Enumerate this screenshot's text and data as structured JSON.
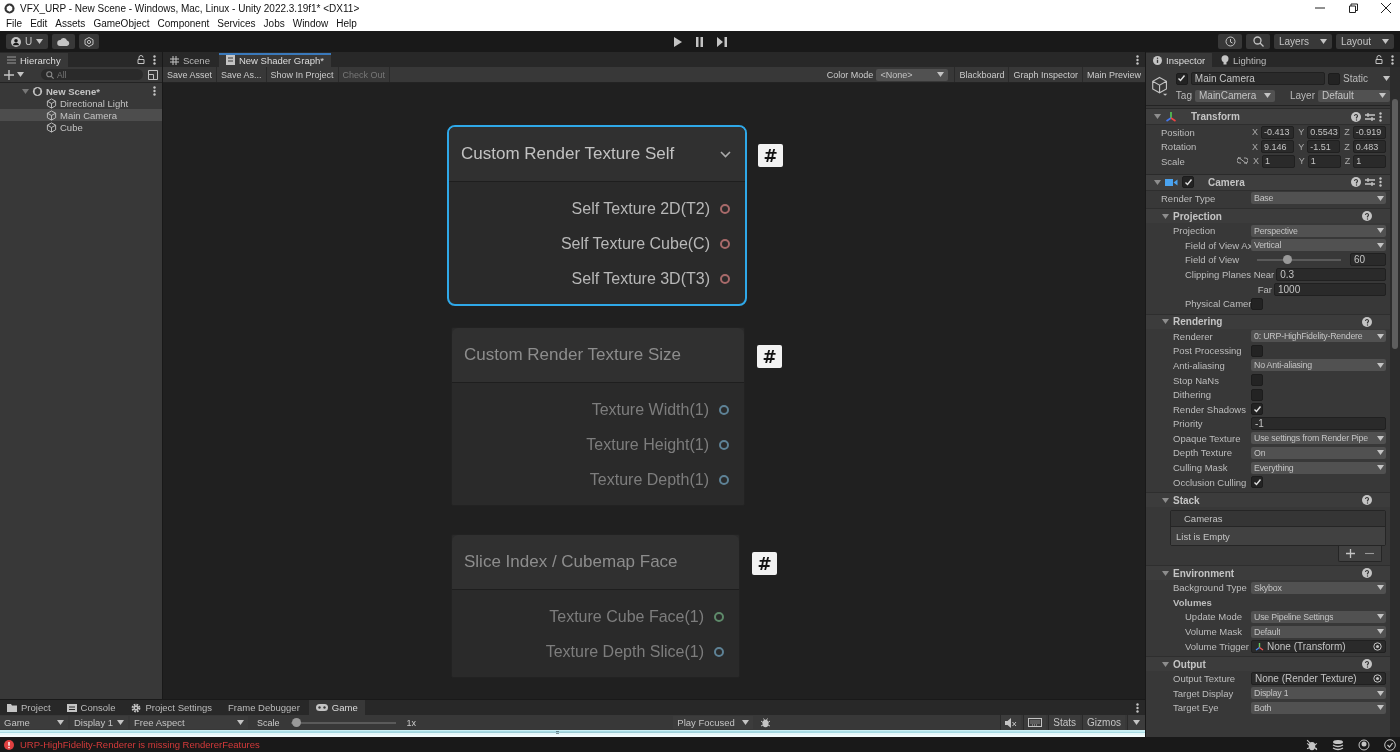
{
  "window": {
    "title": "VFX_URP - New Scene - Windows, Mac, Linux - Unity 2022.3.19f1* <DX11>"
  },
  "menu": [
    "File",
    "Edit",
    "Assets",
    "GameObject",
    "Component",
    "Services",
    "Jobs",
    "Window",
    "Help"
  ],
  "toolbar": {
    "account": "U",
    "layers": "Layers",
    "layout": "Layout"
  },
  "hierarchy": {
    "title": "Hierarchy",
    "search_placeholder": "All",
    "items": [
      {
        "label": "New Scene*",
        "kind": "scene",
        "expanded": true,
        "selected": false,
        "children": [
          {
            "label": "Directional Light",
            "kind": "object",
            "selected": false
          },
          {
            "label": "Main Camera",
            "kind": "object",
            "selected": true
          },
          {
            "label": "Cube",
            "kind": "object",
            "selected": false
          }
        ]
      }
    ]
  },
  "graph": {
    "tabs": [
      {
        "label": "Scene",
        "kind": "scene",
        "selected": false
      },
      {
        "label": "New Shader Graph*",
        "kind": "shader",
        "selected": true
      }
    ],
    "toolbar_left": [
      {
        "label": "Save Asset",
        "disabled": false
      },
      {
        "label": "Save As...",
        "disabled": false
      },
      {
        "label": "Show In Project",
        "disabled": false
      },
      {
        "label": "Check Out",
        "disabled": true
      }
    ],
    "color_mode": {
      "label": "Color Mode",
      "value": "<None>"
    },
    "toolbar_right": [
      "Blackboard",
      "Graph Inspector",
      "Main Preview"
    ],
    "nodes": [
      {
        "title": "Custom Render Texture Self",
        "selected": true,
        "badge": "#",
        "ports": [
          {
            "label": "Self Texture 2D(T2)",
            "color": "#a86a6a"
          },
          {
            "label": "Self Texture Cube(C)",
            "color": "#a86a6a"
          },
          {
            "label": "Self Texture 3D(T3)",
            "color": "#a86a6a"
          }
        ]
      },
      {
        "title": "Custom Render Texture Size",
        "selected": false,
        "badge": "#",
        "ports": [
          {
            "label": "Texture Width(1)",
            "color": "#5e8296"
          },
          {
            "label": "Texture Height(1)",
            "color": "#5e8296"
          },
          {
            "label": "Texture Depth(1)",
            "color": "#5e8296"
          }
        ]
      },
      {
        "title": "Slice Index / Cubemap Face",
        "selected": false,
        "badge": "#",
        "ports": [
          {
            "label": "Texture Cube Face(1)",
            "color": "#5e8a6a"
          },
          {
            "label": "Texture Depth Slice(1)",
            "color": "#5e8296"
          }
        ]
      }
    ]
  },
  "inspector": {
    "tabs": [
      {
        "label": "Inspector",
        "kind": "info",
        "selected": true
      },
      {
        "label": "Lighting",
        "kind": "light",
        "selected": false
      }
    ],
    "object": {
      "active": true,
      "name": "Main Camera",
      "static": false,
      "static_label": "Static",
      "tag_label": "Tag",
      "tag": "MainCamera",
      "layer_label": "Layer",
      "layer": "Default"
    },
    "components": [
      {
        "title": "Transform",
        "kind": "transform",
        "rows": [
          {
            "kind": "vector3",
            "label": "Position",
            "values": [
              {
                "axis": "X",
                "value": "-0.413"
              },
              {
                "axis": "Y",
                "value": "0.5543"
              },
              {
                "axis": "Z",
                "value": "-0.919"
              }
            ]
          },
          {
            "kind": "vector3",
            "label": "Rotation",
            "values": [
              {
                "axis": "X",
                "value": "9.146"
              },
              {
                "axis": "Y",
                "value": "-1.51"
              },
              {
                "axis": "Z",
                "value": "0.483"
              }
            ]
          },
          {
            "kind": "scale",
            "label": "Scale",
            "values": [
              {
                "axis": "X",
                "value": "1"
              },
              {
                "axis": "Y",
                "value": "1"
              },
              {
                "axis": "Z",
                "value": "1"
              }
            ]
          }
        ]
      },
      {
        "title": "Camera",
        "kind": "camera",
        "enabled": true,
        "rows": [
          {
            "kind": "dropdown",
            "label": "Render Type",
            "value": "Base"
          }
        ],
        "sections": [
          {
            "title": "Projection",
            "rows": [
              {
                "kind": "dropdown",
                "label": "Projection",
                "value": "Perspective",
                "children": [
                  {
                    "kind": "dropdown",
                    "label": "Field of View Ax",
                    "value": "Vertical"
                  },
                  {
                    "kind": "slider",
                    "label": "Field of View",
                    "level": 0.34,
                    "value": "60"
                  },
                  {
                    "kind": "clip",
                    "label": "Clipping Planes Near",
                    "value": "0.3"
                  },
                  {
                    "kind": "clip",
                    "label": "Far",
                    "value": "1000"
                  },
                  {
                    "kind": "checkbox",
                    "label": "Physical Camer",
                    "checked": false
                  }
                ]
              }
            ]
          },
          {
            "title": "Rendering",
            "rows": [
              {
                "kind": "dropdown",
                "label": "Renderer",
                "value": "0: URP-HighFidelity-Rendere"
              },
              {
                "kind": "checkbox",
                "label": "Post Processing",
                "checked": false
              },
              {
                "kind": "dropdown",
                "label": "Anti-aliasing",
                "value": "No Anti-aliasing"
              },
              {
                "kind": "checkbox",
                "label": "Stop NaNs",
                "checked": false
              },
              {
                "kind": "checkbox",
                "label": "Dithering",
                "checked": false
              },
              {
                "kind": "checkbox",
                "label": "Render Shadows",
                "checked": true
              },
              {
                "kind": "field",
                "label": "Priority",
                "value": "-1"
              },
              {
                "kind": "dropdown",
                "label": "Opaque Texture",
                "value": "Use settings from Render Pipe"
              },
              {
                "kind": "dropdown",
                "label": "Depth Texture",
                "value": "On"
              },
              {
                "kind": "dropdown",
                "label": "Culling Mask",
                "value": "Everything"
              },
              {
                "kind": "checkbox",
                "label": "Occlusion Culling",
                "checked": true
              }
            ]
          },
          {
            "title": "Stack",
            "rows": [
              {
                "kind": "list",
                "label": "Cameras",
                "value": "List is Empty"
              }
            ]
          },
          {
            "title": "Environment",
            "rows": [
              {
                "kind": "dropdown",
                "label": "Background Type",
                "value": "Skybox"
              },
              {
                "kind": "heading",
                "label": "Volumes",
                "children": [
                  {
                    "kind": "dropdown",
                    "label": "Update Mode",
                    "value": "Use Pipeline Settings"
                  },
                  {
                    "kind": "dropdown",
                    "label": "Volume Mask",
                    "value": "Default"
                  },
                  {
                    "kind": "transform-ref",
                    "label": "Volume Trigger",
                    "value": "None (Transform)"
                  }
                ]
              }
            ]
          },
          {
            "title": "Output",
            "rows": [
              {
                "kind": "object",
                "label": "Output Texture",
                "value": "None (Render Texture)"
              },
              {
                "kind": "dropdown",
                "label": "Target Display",
                "value": "Display 1"
              },
              {
                "kind": "dropdown",
                "label": "Target Eye",
                "value": "Both"
              }
            ]
          }
        ]
      }
    ]
  },
  "game": {
    "tabs": [
      {
        "label": "Project",
        "kind": "folder",
        "selected": false
      },
      {
        "label": "Console",
        "kind": "console",
        "selected": false
      },
      {
        "label": "Project Settings",
        "kind": "gear",
        "selected": false
      },
      {
        "label": "Frame Debugger",
        "kind": "plain",
        "selected": false
      },
      {
        "label": "Game",
        "kind": "game",
        "selected": true
      }
    ],
    "view": "Game",
    "display": "Display 1",
    "aspect": "Free Aspect",
    "scale_label": "Scale",
    "scale": {
      "level": 0.02
    },
    "scale_value": "1x",
    "play_mode": "Play Focused",
    "stats": "Stats",
    "gizmos": "Gizmos"
  },
  "status": {
    "error": "URP-HighFidelity-Renderer is missing RendererFeatures"
  }
}
